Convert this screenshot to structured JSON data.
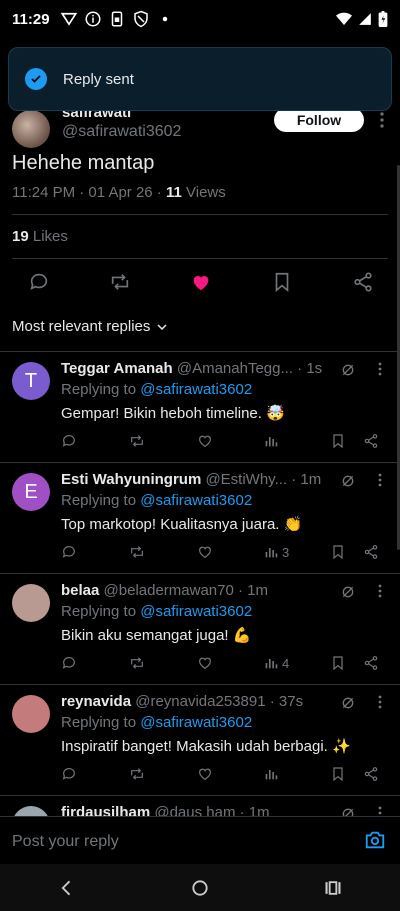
{
  "status_bar": {
    "time": "11:29",
    "icons": [
      "vpn-icon",
      "info-icon",
      "sim-icon",
      "shield-icon",
      "dot-icon"
    ],
    "right_icons": [
      "wifi-icon",
      "signal-icon",
      "battery-icon"
    ]
  },
  "toast": {
    "message": "Reply sent",
    "icon": "check-circle-icon"
  },
  "post": {
    "author_name": "safirawati",
    "author_handle": "@safirawati3602",
    "follow_label": "Follow",
    "text": "Hehehe mantap",
    "time": "11:24 PM · 01 Apr 26 · ",
    "views_count": "11",
    "views_label": " Views",
    "likes_count": "19",
    "likes_label": " Likes"
  },
  "sort": {
    "label": "Most relevant replies"
  },
  "replies": [
    {
      "name": "Teggar Amanah",
      "handle": "@AmanahTegg...",
      "time": "· 1s",
      "avatar_letter": "T",
      "avatar_color": "#7b5ccf",
      "replying_prefix": "Replying to ",
      "replying_to": "@safirawati3602",
      "text": "Gempar! Bikin heboh timeline. 🤯",
      "views": ""
    },
    {
      "name": "Esti Wahyuningrum",
      "handle": "@EstiWhy...",
      "time": "· 1m",
      "avatar_letter": "E",
      "avatar_color": "#a04fc4",
      "replying_prefix": "Replying to ",
      "replying_to": "@safirawati3602",
      "text": "Top markotop! Kualitasnya juara. 👏",
      "views": "3"
    },
    {
      "name": "belaa",
      "handle": "@beladermawan70",
      "time": "· 1m",
      "avatar_letter": "",
      "avatar_color": "#b89a92",
      "replying_prefix": "Replying to ",
      "replying_to": "@safirawati3602",
      "text": "Bikin aku semangat juga! 💪",
      "views": "4"
    },
    {
      "name": "reynavida",
      "handle": "@reynavida253891",
      "time": "· 37s",
      "avatar_letter": "",
      "avatar_color": "#c47b7b",
      "replying_prefix": "Replying to ",
      "replying_to": "@safirawati3602",
      "text": "Inspiratif banget! Makasih udah berbagi. ✨",
      "views": ""
    },
    {
      "name": "firdausilham",
      "handle": "@daus ham",
      "time": "· 1m",
      "avatar_letter": "",
      "avatar_color": "#9aa5ad",
      "replying_prefix": "",
      "replying_to": "",
      "text": "",
      "views": ""
    }
  ],
  "composer": {
    "placeholder": "Post your reply"
  },
  "colors": {
    "accent": "#1d9bf0",
    "like": "#f91880",
    "background": "#000000",
    "muted": "#71767b"
  }
}
